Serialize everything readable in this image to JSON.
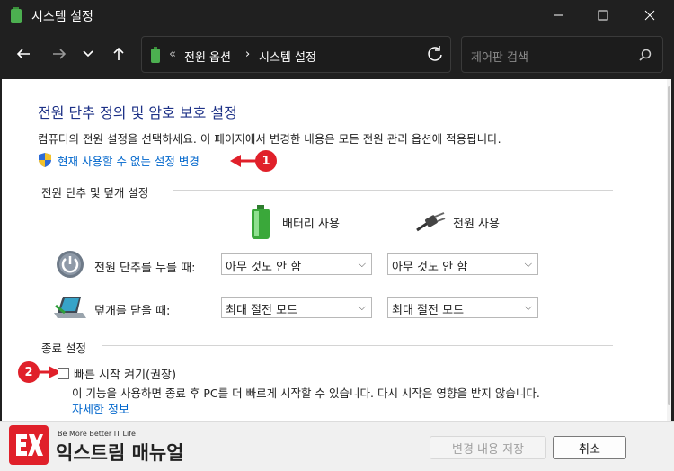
{
  "window": {
    "title": "시스템 설정"
  },
  "breadcrumb": {
    "sep1": "«",
    "item1": "전원 옵션",
    "sep2": "›",
    "item2": "시스템 설정"
  },
  "search": {
    "placeholder": "제어판 검색"
  },
  "page": {
    "heading": "전원 단추 정의 및 암호 보호 설정",
    "description": "컴퓨터의 전원 설정을 선택하세요. 이 페이지에서 변경한 내용은 모든 전원 관리 옵션에 적용됩니다.",
    "uac_link": "현재 사용할 수 없는 설정 변경"
  },
  "power_section": {
    "title": "전원 단추 및 덮개 설정",
    "columns": [
      "배터리 사용",
      "전원 사용"
    ],
    "rows": [
      {
        "label": "전원 단추를 누를 때:",
        "battery": "아무 것도 안 함",
        "plugged": "아무 것도 안 함"
      },
      {
        "label": "덮개를 닫을 때:",
        "battery": "최대 절전 모드",
        "plugged": "최대 절전 모드"
      }
    ]
  },
  "shutdown_section": {
    "title": "종료 설정",
    "fast_startup_label": "빠른 시작 켜기(권장)",
    "fast_startup_checked": false,
    "fast_startup_desc": "이 기능을 사용하면 종료 후 PC를 더 빠르게 시작할 수 있습니다. 다시 시작은 영향을 받지 않습니다.",
    "more_info": "자세한 정보"
  },
  "callouts": [
    "1",
    "2"
  ],
  "footer": {
    "brand_tag": "Be More Better IT Life",
    "brand_name": "익스트림 매뉴얼",
    "save_button": "변경 내용 저장",
    "cancel_button": "취소"
  },
  "colors": {
    "accent": "#0066cc",
    "heading": "#1e3287",
    "callout": "#e0202a",
    "titlebar": "#202020"
  }
}
